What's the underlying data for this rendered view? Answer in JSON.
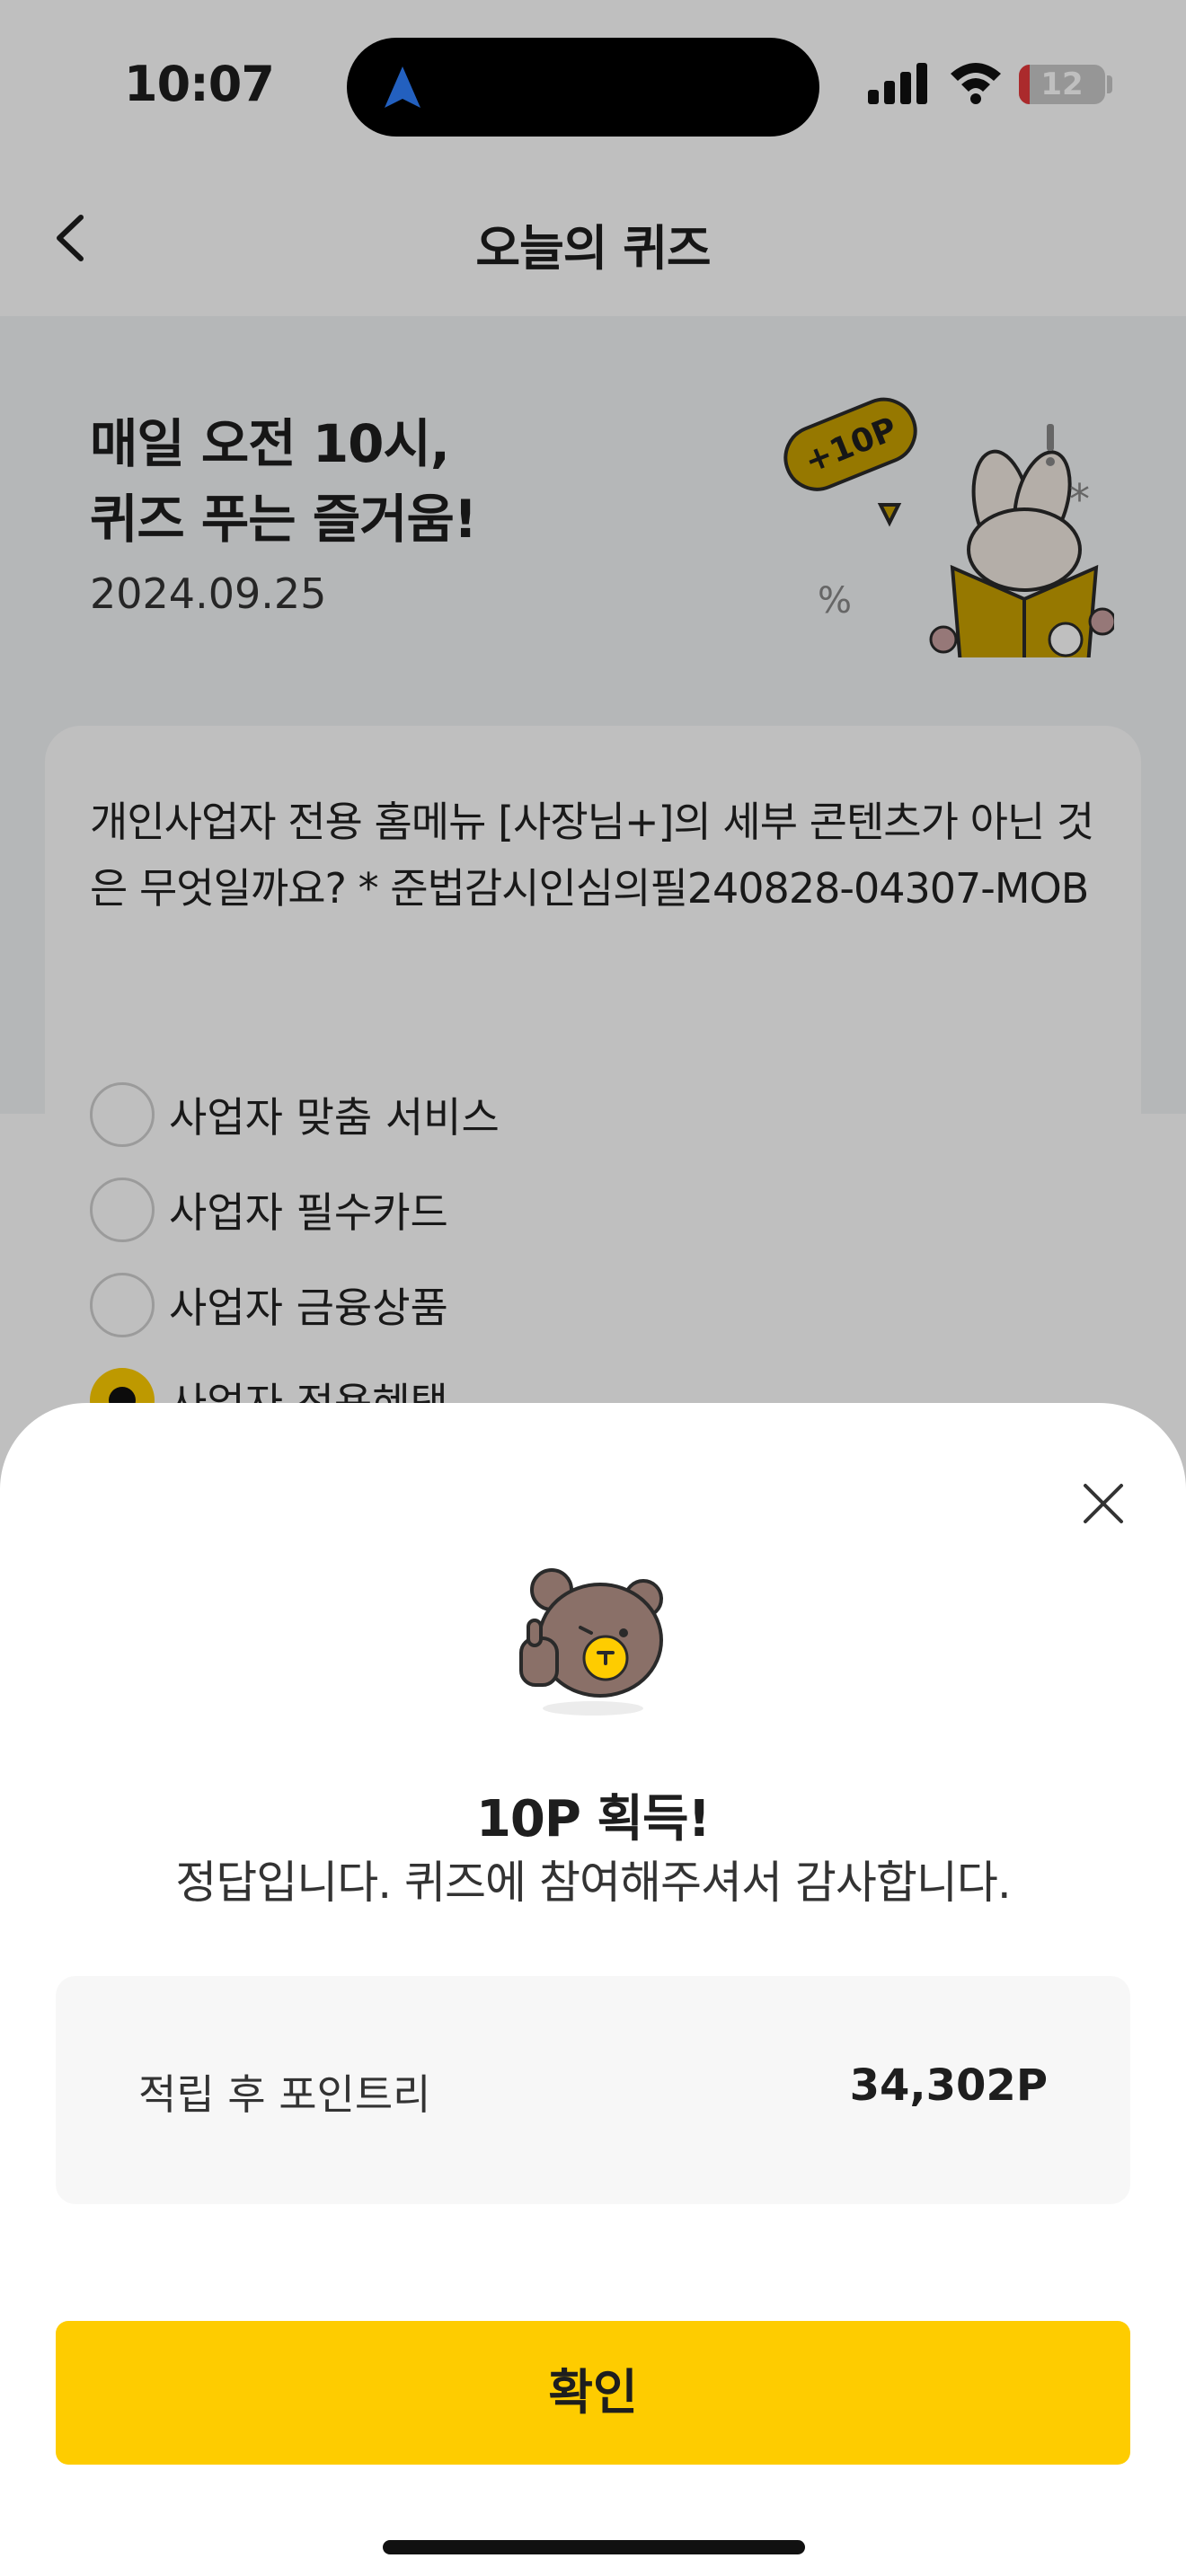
{
  "status_bar": {
    "time": "10:07",
    "battery": "12",
    "battery_level": 0.12,
    "icons": [
      "location-arrow-icon",
      "cellular-signal-icon",
      "wifi-icon",
      "battery-icon"
    ]
  },
  "header": {
    "title": "오늘의 퀴즈",
    "back_icon": "chevron-left-icon"
  },
  "hero": {
    "title_line1": "매일 오전 10시,",
    "title_line2": "퀴즈 푸는 즐거움!",
    "date": "2024.09.25",
    "badge": "+10P"
  },
  "quiz": {
    "question": "개인사업자 전용 홈메뉴 [사장님+]의 세부 콘텐츠가 아닌 것은 무엇일까요? * 준법감시인심의필240828-04307-MOB",
    "options": [
      {
        "label": "사업자 맞춤 서비스",
        "selected": false
      },
      {
        "label": "사업자 필수카드",
        "selected": false
      },
      {
        "label": "사업자 금융상품",
        "selected": false
      },
      {
        "label": "사업자 전용혜택",
        "selected": true
      }
    ]
  },
  "sheet": {
    "close_icon": "close-icon",
    "reward_title": "10P 획득!",
    "reward_message": "정답입니다. 퀴즈에 참여해주셔서 감사합니다.",
    "points_label": "적립 후 포인트리",
    "points_value": "34,302P",
    "confirm_label": "확인"
  },
  "colors": {
    "accent": "#fecc00",
    "dim_overlay": "rgba(0,0,0,0.25)",
    "surface": "#f7f7f7"
  }
}
